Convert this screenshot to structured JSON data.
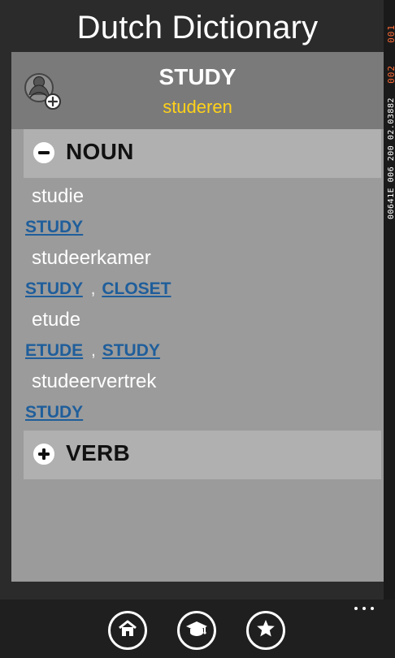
{
  "app": {
    "title": "Dutch Dictionary"
  },
  "header": {
    "word": "STUDY",
    "translation": "studeren",
    "icon": "user-add-icon"
  },
  "sections": {
    "noun": {
      "label": "NOUN",
      "icon": "minus-circle-icon",
      "state": "expanded"
    },
    "verb": {
      "label": "VERB",
      "icon": "plus-circle-icon",
      "state": "collapsed"
    }
  },
  "entries": [
    {
      "term": "studie",
      "links": [
        "STUDY"
      ]
    },
    {
      "term": "studeerkamer",
      "links": [
        "STUDY",
        "CLOSET"
      ]
    },
    {
      "term": "etude",
      "links": [
        "ETUDE",
        "STUDY"
      ]
    },
    {
      "term": "studeervertrek",
      "links": [
        "STUDY"
      ]
    }
  ],
  "link_separator": ",",
  "status_overlay": {
    "item1": "001",
    "item2": "002",
    "item3": "00641E 006 200 02.03882"
  },
  "bottom_bar": {
    "buttons": [
      {
        "icon": "home-icon"
      },
      {
        "icon": "graduation-cap-icon"
      },
      {
        "icon": "star-icon"
      }
    ],
    "more_icon": "more-dots-icon"
  },
  "colors": {
    "background": "#2b2b2b",
    "panel": "#9b9b9b",
    "header": "#7a7a7a",
    "section": "#b0b0b0",
    "translation": "#ffd21a",
    "link": "#1f5e9b",
    "status_accent": "#ff6b35"
  }
}
